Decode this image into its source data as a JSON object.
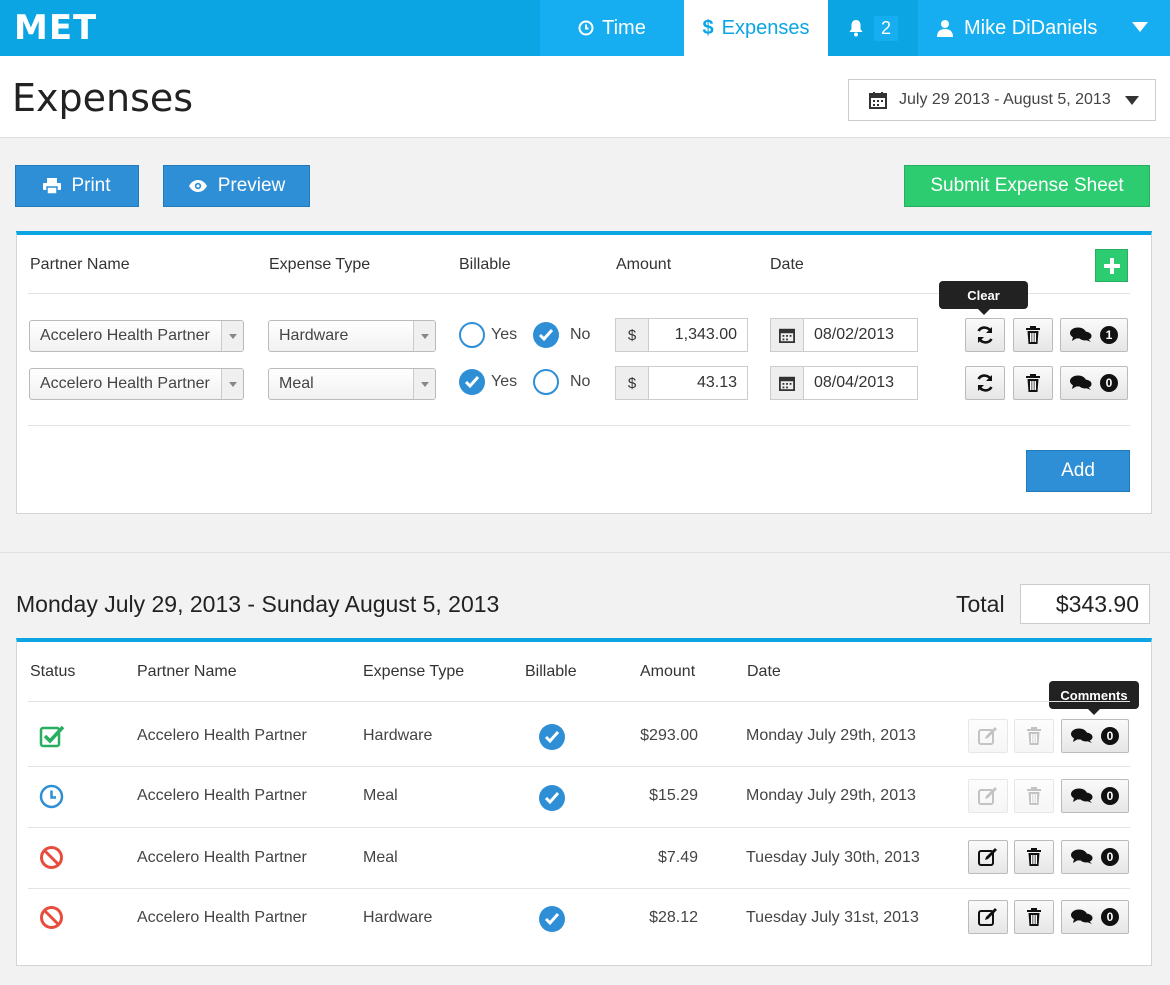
{
  "nav": {
    "logo": "MET",
    "time_label": "Time",
    "expenses_label": "Expenses",
    "notification_count": "2",
    "user_name": "Mike DiDaniels"
  },
  "page": {
    "title": "Expenses",
    "date_range": "July 29 2013 - August 5, 2013"
  },
  "actions": {
    "print_label": "Print",
    "preview_label": "Preview",
    "submit_label": "Submit Expense Sheet"
  },
  "form": {
    "headers": {
      "partner_name": "Partner Name",
      "expense_type": "Expense Type",
      "billable": "Billable",
      "amount": "Amount",
      "date": "Date"
    },
    "yes_label": "Yes",
    "no_label": "No",
    "currency": "$",
    "clear_tooltip": "Clear",
    "add_label": "Add",
    "rows": [
      {
        "partner": "Accelero Health Partner",
        "type": "Hardware",
        "billable": "No",
        "amount": "1,343.00",
        "date": "08/02/2013",
        "comments": "1"
      },
      {
        "partner": "Accelero Health Partner",
        "type": "Meal",
        "billable": "Yes",
        "amount": "43.13",
        "date": "08/04/2013",
        "comments": "0"
      }
    ]
  },
  "summary": {
    "range_title": "Monday July 29, 2013  -  Sunday August 5, 2013",
    "total_label": "Total",
    "total_value": "$343.90",
    "headers": {
      "status": "Status",
      "partner_name": "Partner Name",
      "expense_type": "Expense Type",
      "billable": "Billable",
      "amount": "Amount",
      "date": "Date"
    },
    "comments_tooltip": "Comments",
    "rows": [
      {
        "status": "approved",
        "partner": "Accelero Health Partner",
        "type": "Hardware",
        "billable": true,
        "amount": "$293.00",
        "date": "Monday July 29th, 2013",
        "comments": "0",
        "editable": false
      },
      {
        "status": "pending",
        "partner": "Accelero Health Partner",
        "type": "Meal",
        "billable": true,
        "amount": "$15.29",
        "date": "Monday July 29th, 2013",
        "comments": "0",
        "editable": false
      },
      {
        "status": "rejected",
        "partner": "Accelero Health Partner",
        "type": "Meal",
        "billable": false,
        "amount": "$7.49",
        "date": "Tuesday July 30th, 2013",
        "comments": "0",
        "editable": true
      },
      {
        "status": "rejected",
        "partner": "Accelero Health Partner",
        "type": "Hardware",
        "billable": true,
        "amount": "$28.12",
        "date": "Tuesday July 31st, 2013",
        "comments": "0",
        "editable": true
      }
    ]
  },
  "colors": {
    "brand": "#0ba5e4",
    "primary_button": "#2e8fd6",
    "submit_button": "#2ecc71",
    "approved": "#27ae60",
    "pending": "#2e8fd6",
    "rejected": "#e74c3c"
  }
}
